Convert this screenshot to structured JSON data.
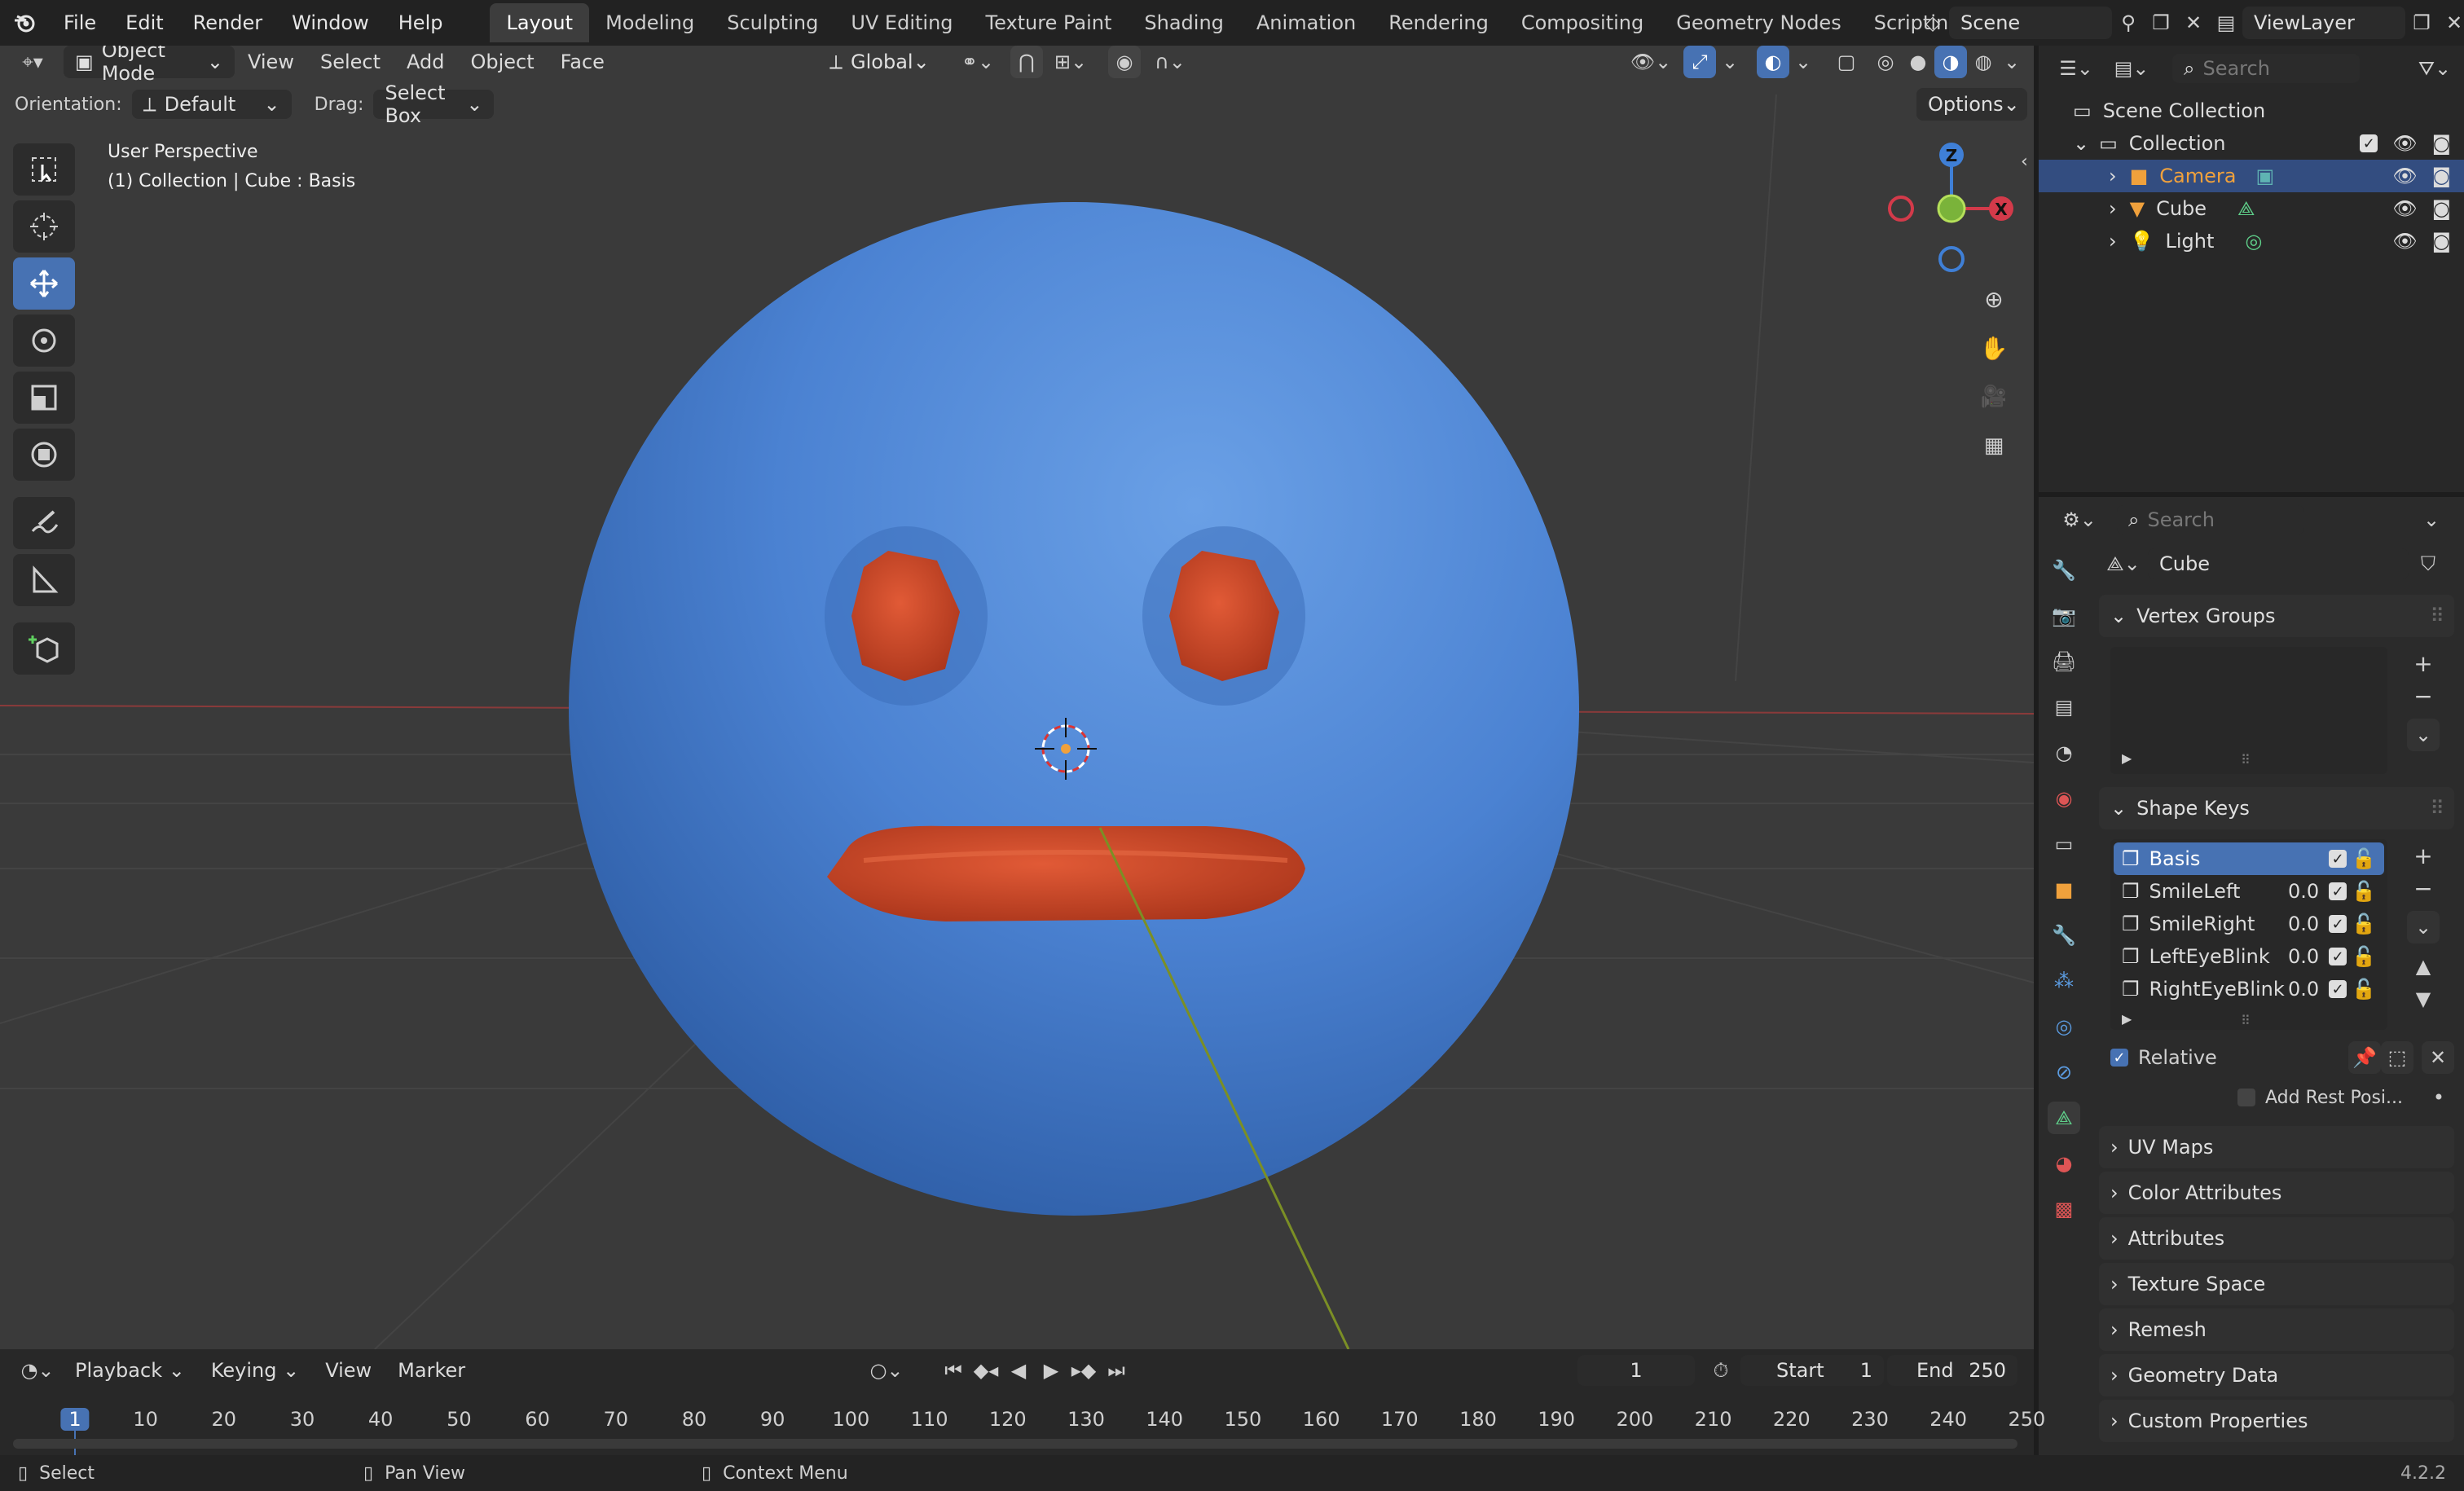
{
  "topbar": {
    "menus": [
      "File",
      "Edit",
      "Render",
      "Window",
      "Help"
    ],
    "workspaces": [
      "Layout",
      "Modeling",
      "Sculpting",
      "UV Editing",
      "Texture Paint",
      "Shading",
      "Animation",
      "Rendering",
      "Compositing",
      "Geometry Nodes",
      "Scripting"
    ],
    "active_workspace": "Layout",
    "scene": "Scene",
    "view_layer": "ViewLayer"
  },
  "viewport_header": {
    "mode": "Object Mode",
    "menus": [
      "View",
      "Select",
      "Add",
      "Object",
      "Face"
    ],
    "transform_orientation": "Global",
    "orientation_label": "Orientation:",
    "orientation_value": "Default",
    "drag_label": "Drag:",
    "drag_value": "Select Box",
    "options": "Options"
  },
  "viewport": {
    "perspective": "User Perspective",
    "context": "(1) Collection | Cube : Basis",
    "gizmo_axes": {
      "z": "Z",
      "x": "X"
    }
  },
  "outliner": {
    "search_placeholder": "Search",
    "scene_collection": "Scene Collection",
    "collection": "Collection",
    "items": [
      {
        "name": "Camera",
        "selected": true
      },
      {
        "name": "Cube",
        "selected": false
      },
      {
        "name": "Light",
        "selected": false
      }
    ]
  },
  "properties": {
    "search_placeholder": "Search",
    "object_name": "Cube",
    "vertex_groups": "Vertex Groups",
    "shape_keys_title": "Shape Keys",
    "shape_keys": [
      {
        "name": "Basis",
        "value": "",
        "selected": true
      },
      {
        "name": "SmileLeft",
        "value": "0.0",
        "selected": false
      },
      {
        "name": "SmileRight",
        "value": "0.0",
        "selected": false
      },
      {
        "name": "LeftEyeBlink",
        "value": "0.0",
        "selected": false
      },
      {
        "name": "RightEyeBlink",
        "value": "0.0",
        "selected": false
      }
    ],
    "relative_label": "Relative",
    "add_rest_label": "Add Rest Posi...",
    "collapsed_sections": [
      "UV Maps",
      "Color Attributes",
      "Attributes",
      "Texture Space",
      "Remesh",
      "Geometry Data",
      "Custom Properties"
    ]
  },
  "timeline": {
    "menus": [
      "Playback",
      "Keying",
      "View",
      "Marker"
    ],
    "current_frame": "1",
    "start_label": "Start",
    "start_value": "1",
    "end_label": "End",
    "end_value": "250",
    "ticks": [
      "1",
      "10",
      "20",
      "30",
      "40",
      "50",
      "60",
      "70",
      "80",
      "90",
      "100",
      "110",
      "120",
      "130",
      "140",
      "150",
      "160",
      "170",
      "180",
      "190",
      "200",
      "210",
      "220",
      "230",
      "240",
      "250"
    ]
  },
  "statusbar": {
    "select": "Select",
    "pan": "Pan View",
    "context": "Context Menu",
    "version": "4.2.2"
  },
  "colors": {
    "accent": "#4772b3",
    "selected_orange": "#f0a13c",
    "sphere_blue": "#4a82d4",
    "feature_red": "#c54524"
  }
}
